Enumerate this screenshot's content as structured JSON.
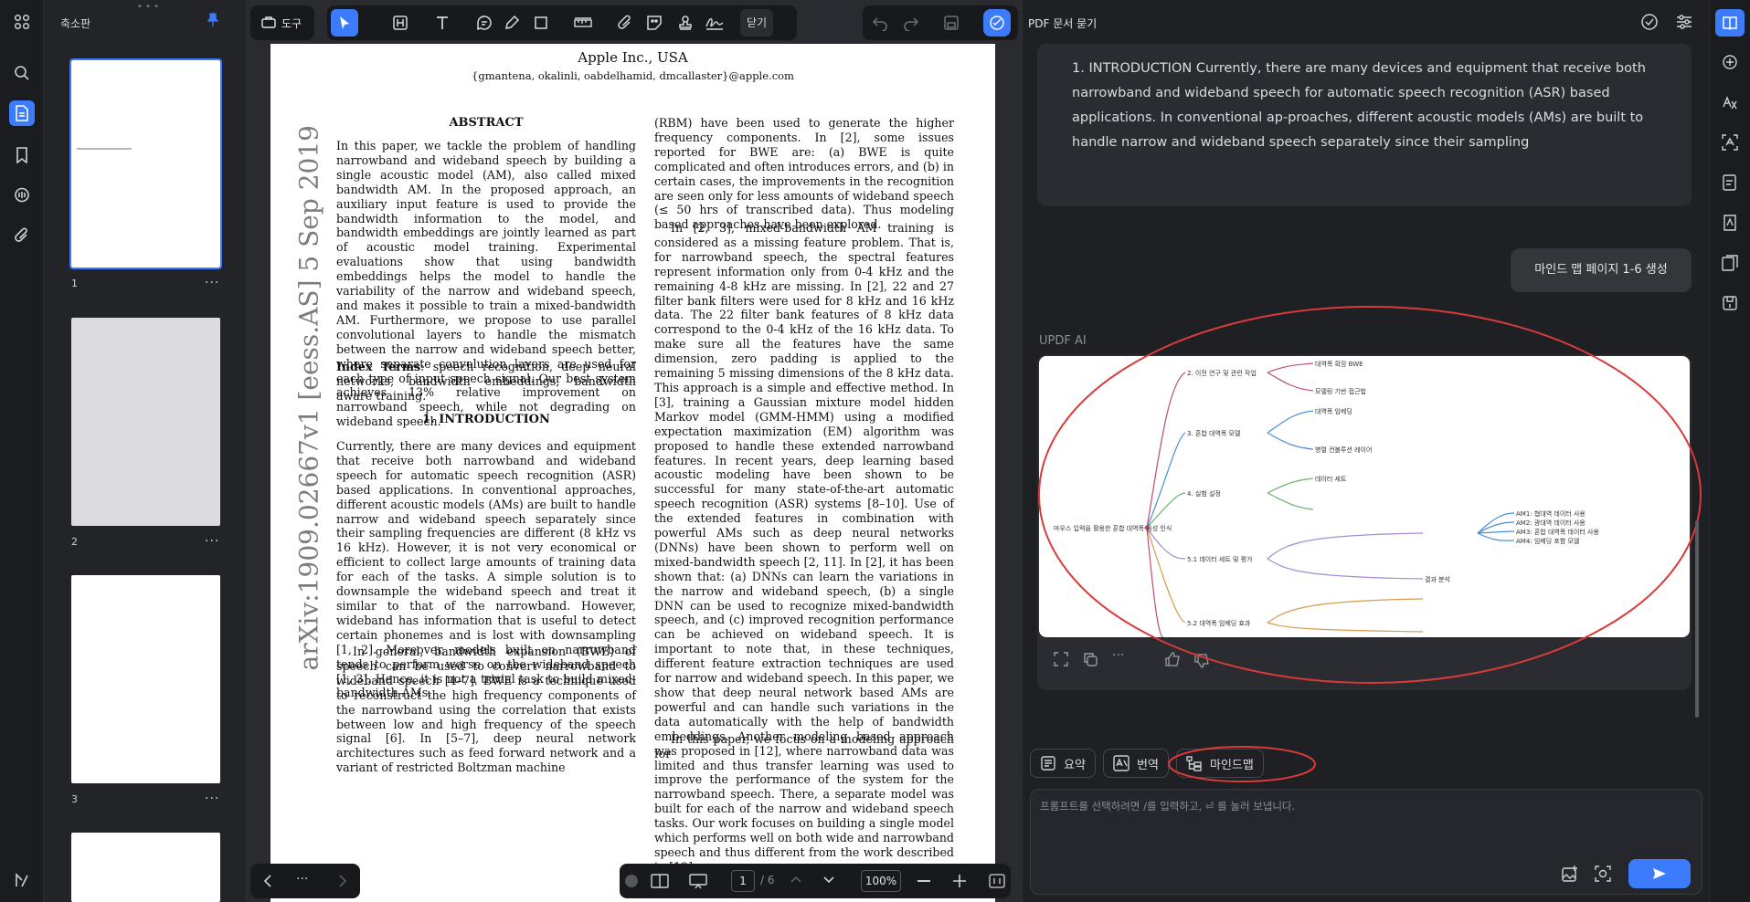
{
  "thumbnails": {
    "title": "축소판",
    "pages": [
      {
        "num": "1",
        "more": "···"
      },
      {
        "num": "2",
        "more": "···"
      },
      {
        "num": "3",
        "more": "···"
      }
    ]
  },
  "toolbar": {
    "tools_label": "도구",
    "close_label": "닫기"
  },
  "document": {
    "affiliation": "Apple Inc., USA",
    "emails": "{gmantena, okalinli, oabdelhamid, dmcallaster}@apple.com",
    "arxiv_stamp": "arXiv:1909.02667v1  [eess.AS]  5 Sep 2019",
    "abstract_heading": "ABSTRACT",
    "abstract": "In this paper, we tackle the problem of handling narrowband and wideband speech by building a single acoustic model (AM), also called mixed bandwidth AM. In the proposed approach, an auxiliary input feature is used to provide the bandwidth information to the model, and bandwidth embeddings are jointly learned as part of acoustic model training. Experimental evaluations show that using bandwidth embeddings helps the model to handle the variability of the narrow and wideband speech, and makes it possible to train a mixed-bandwidth AM. Furthermore, we propose to use parallel convolutional layers to handle the mismatch between the narrow and wideband speech better, where separate convolution layers are used for each type of input speech signal. Our best system achieves 13% relative improvement on narrowband speech, while not degrading on wideband speech.",
    "index_terms_label": "Index Terms",
    "index_terms": ": speech recognition, deep neural networks, bandwidth embeddings, bandwidth aware training.",
    "intro_heading": "1.  INTRODUCTION",
    "intro_p1": "Currently, there are many devices and equipment that receive both narrowband and wideband speech for automatic speech recognition (ASR) based applications. In conventional approaches, different acoustic models (AMs) are built to handle narrow and wideband speech separately since their sampling frequencies are different (8 kHz vs 16 kHz). However, it is not very economical or efficient to collect large amounts of training data for each of the tasks. A simple solution is to downsample the wideband speech and treat it similar to that of the narrowband. However, wideband has information that is useful to detect certain phonemes and is lost with downsampling [1, 2]. Moreover, models built on narrowband tends to perform worse on the wideband speech [1, 3]. Hence, it is not a trivial task to build mixed-bandwidth AMs.",
    "intro_p2": "In general, bandwidth expansion (BWE) of speech can be used to convert narrowband to wideband speech [4–7]. BWE is a technique used to reconstruct the high frequency components of the narrowband using the correlation that exists between low and high frequency of the speech signal [6]. In [5–7], deep neural network architectures such as feed forward network and a variant of restricted Boltzman machine",
    "col2_p1": "(RBM) have been used to generate the higher frequency components. In [2], some issues reported for BWE are: (a) BWE is quite complicated and often introduces errors, and (b) in certain cases, the improvements in the recognition are seen only for less amounts of wideband speech (≤ 50 hrs of transcribed data). Thus modeling based approaches have been explored.",
    "col2_p2": "In [2, 3], mixed-bandwidth AM training is considered as a missing feature problem. That is, for narrowband speech, the spectral features represent information only from 0-4 kHz and the remaining 4-8 kHz are missing. In [2], 22 and 27 filter bank filters were used for 8 kHz and 16 kHz data. The 22 filter bank features of 8 kHz data correspond to the 0-4 kHz of the 16 kHz data. To make sure all the features have the same dimension, zero padding is applied to the remaining 5 missing dimensions of the 8 kHz data. This approach is a simple and effective method. In [3], training a Gaussian mixture model hidden Markov model (GMM-HMM) using a modified expectation maximization (EM) algorithm was proposed to handle these extended narrowband features. In recent years, deep learning based acoustic modeling have been shown to be successful for many state-of-the-art automatic speech recognition (ASR) systems [8–10]. Use of the extended features in combination with powerful AMs such as deep neural networks (DNNs) have been shown to perform well on mixed-bandwidth speech [2, 11]. In [2], it has been shown that: (a) DNNs can learn the variations in the narrow and wideband speech, (b) a single DNN can be used to recognize mixed-bandwidth speech, and (c) improved recognition performance can be achieved on wideband speech. It is important to note that, in these techniques, different feature extraction techniques are used for narrow and wideband speech. In this paper, we show that deep neural network based AMs are powerful and can handle such variations in the data automatically with the help of bandwidth embeddings. Another modeling based approach was proposed in [12], where narrowband data was limited and thus transfer learning was used to improve the performance of the system for the narrowband speech. There, a separate model was built for each of the narrow and wideband speech tasks. Our work focuses on building a single model which performs well on both wide and narrowband speech and thus different from the work described in [12].",
    "col2_p3": "In this paper, we focus on a modeling approach for"
  },
  "pager": {
    "more": "···",
    "page_current": "1",
    "page_total": "/ 6",
    "zoom": "100%"
  },
  "ai_panel": {
    "title": "PDF 문서 묻기",
    "response_text": "1. INTRODUCTION Currently, there are many devices and equipment that receive both narrowband and wideband speech for automatic speech recognition (ASR) based applications. In conventional ap-proaches, different acoustic models (AMs) are built to handle narrow and wideband speech separately since their sampling",
    "user_message": "마인드 맵 페이지 1-6 생성",
    "ai_label": "UPDF AI",
    "mindmap": {
      "root": "마우스 입력을 활용한 혼합 대역폭 음성 인식",
      "branches": [
        "2. 이전 연구 및 관련 작업",
        "3. 혼합 대역폭 모델",
        "4. 실험 설정",
        "5.1 데이터 세트 및 평가",
        "5.2 대역폭 임베딩 효과"
      ],
      "leaves": [
        "대역폭 확장 BWE",
        "모델링 기반 접근법",
        "대역폭 임베딩",
        "병렬 컨볼루션 레이어",
        "데이터 세트",
        "AM1: 협대역 데이터 사용",
        "AM2: 광대역 데이터 사용",
        "AM3: 혼합 대역폭 데이터 사용",
        "AM4: 임베딩 포함 모델",
        "결과 분석"
      ]
    },
    "chips": {
      "summary": "요약",
      "translate": "번역",
      "mindmap": "마인드맵"
    },
    "prompt_placeholder": "프롬프트를 선택하려면 /를 입력하고, ⏎ 를 눌러 보냅니다."
  },
  "colors": {
    "accent": "#3d7bfd",
    "annotation_red": "#d93a3a"
  }
}
